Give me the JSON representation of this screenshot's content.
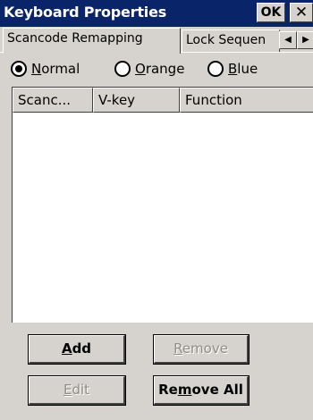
{
  "window": {
    "title": "Keyboard Properties",
    "ok_label": "OK",
    "close_label": "✕"
  },
  "tabs": [
    {
      "label": "Scancode Remapping",
      "active": true
    },
    {
      "label": "Lock Sequen",
      "active": false
    }
  ],
  "tab_scroll": {
    "left": "◀",
    "right": "▶"
  },
  "modes": [
    {
      "label_pre": "",
      "label_u": "N",
      "label_post": "ormal",
      "selected": true
    },
    {
      "label_pre": "",
      "label_u": "O",
      "label_post": "range",
      "selected": false
    },
    {
      "label_pre": "",
      "label_u": "B",
      "label_post": "lue",
      "selected": false
    }
  ],
  "list": {
    "columns": [
      "Scanc...",
      "V-key",
      "Function"
    ],
    "rows": []
  },
  "buttons": {
    "add": {
      "u": "A",
      "rest": "dd",
      "enabled": true
    },
    "remove": {
      "u": "R",
      "rest": "emove",
      "enabled": false
    },
    "edit": {
      "u": "E",
      "rest": "dit",
      "enabled": false
    },
    "remove_all_pre": "Re",
    "remove_all_u": "m",
    "remove_all_post": "ove All"
  },
  "colors": {
    "titlebar": "#0a246a",
    "face": "#d6d3ce"
  }
}
